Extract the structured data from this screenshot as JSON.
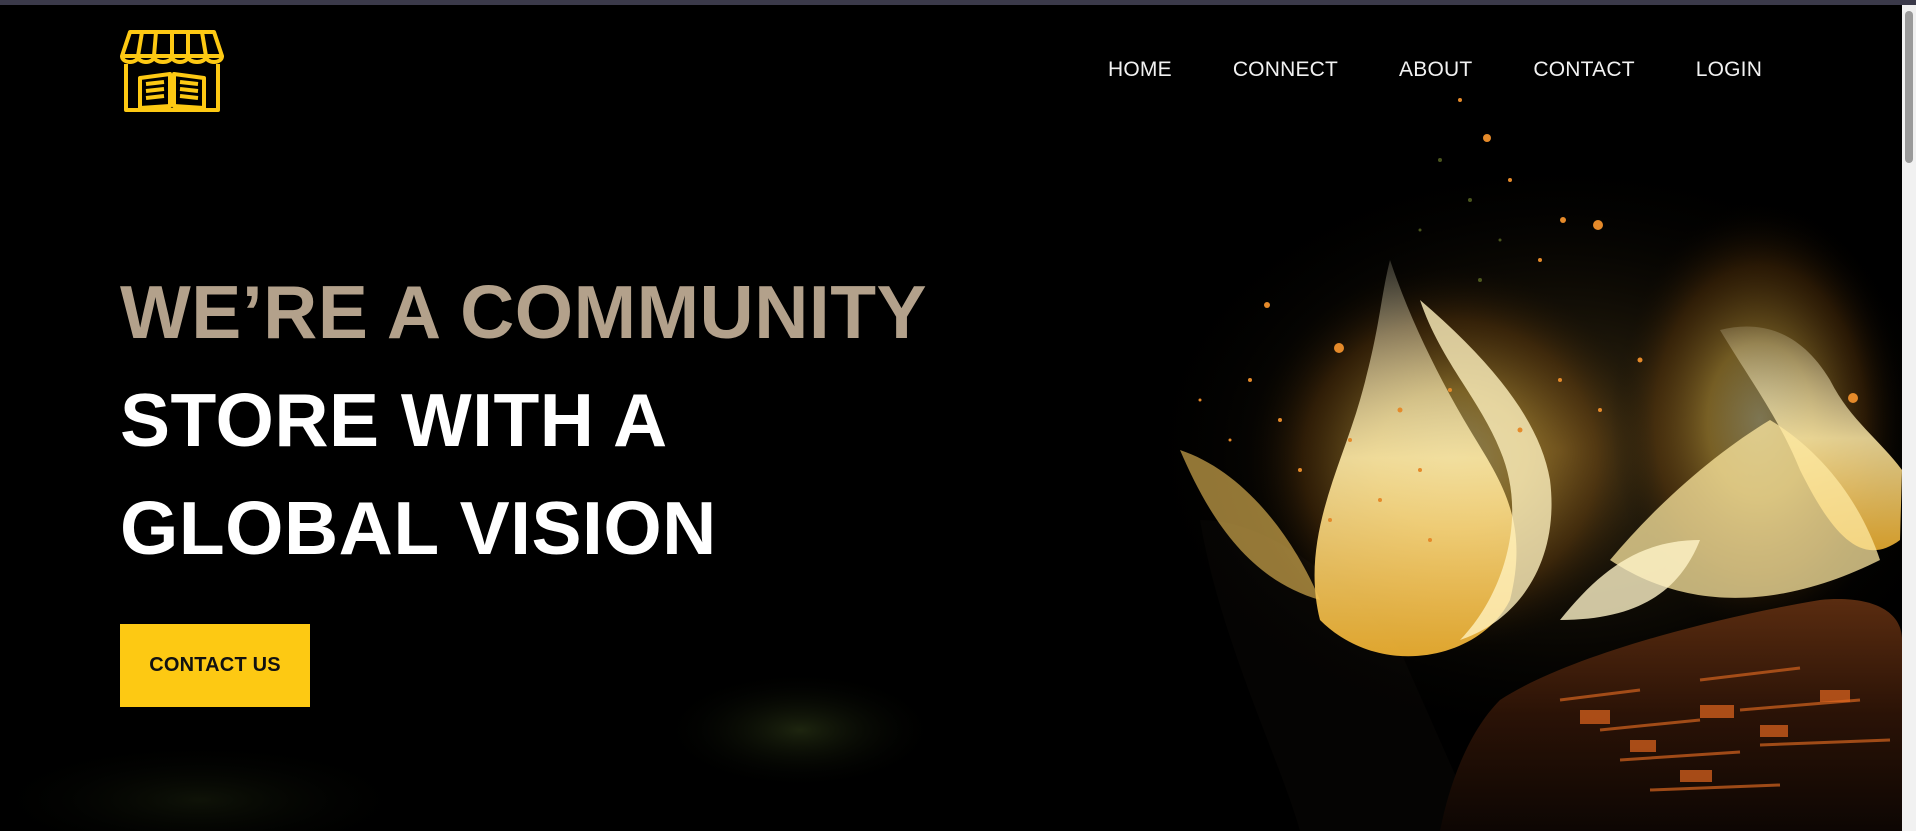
{
  "nav": {
    "items": [
      {
        "label": "HOME"
      },
      {
        "label": "CONNECT"
      },
      {
        "label": "ABOUT"
      },
      {
        "label": "CONTACT"
      },
      {
        "label": "LOGIN"
      }
    ]
  },
  "hero": {
    "headline_line_1": "WE’RE A COMMUNITY",
    "headline_line_2": "STORE WITH A",
    "headline_line_3": "GLOBAL VISION",
    "cta_label": "CONTACT US"
  },
  "logo": {
    "icon": "bookstore-storefront-icon",
    "color": "#fdc913"
  },
  "colors": {
    "accent": "#fdc913",
    "headline_muted": "#b3a18b",
    "background": "#000000"
  }
}
